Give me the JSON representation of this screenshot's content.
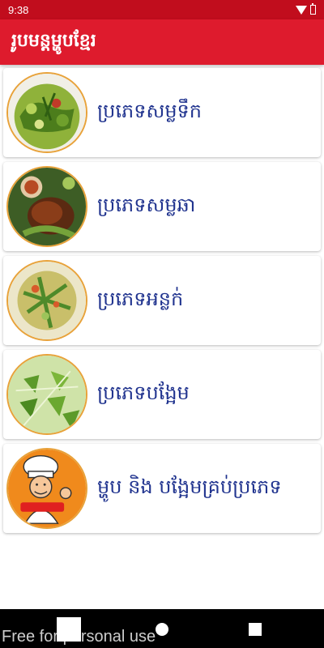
{
  "status_bar": {
    "time": "9:38",
    "background": "#c10d1d"
  },
  "app_bar": {
    "title": "រូបមន្តម្ហូបខ្មែរ",
    "background": "#de1b2d"
  },
  "categories": [
    {
      "label": "ប្រភេទសម្លទឹក",
      "icon": "soup-dish-icon"
    },
    {
      "label": "ប្រភេទសម្លឆា",
      "icon": "grilled-chicken-icon"
    },
    {
      "label": "ប្រភេទអន្លក់",
      "icon": "fresh-vegetables-icon"
    },
    {
      "label": "ប្រភេទបង្អែម",
      "icon": "dessert-icon"
    },
    {
      "label": "ម្ហូប និង បង្អែមគ្រប់ប្រភេទ",
      "icon": "chef-icon"
    }
  ],
  "label_color": "#21348f",
  "watermark": "Free for personal use"
}
